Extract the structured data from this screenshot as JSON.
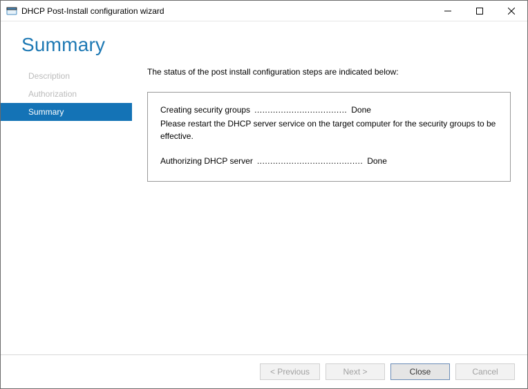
{
  "window": {
    "title": "DHCP Post-Install configuration wizard"
  },
  "header": {
    "title": "Summary"
  },
  "sidebar": {
    "items": [
      {
        "label": "Description",
        "active": false
      },
      {
        "label": "Authorization",
        "active": false
      },
      {
        "label": "Summary",
        "active": true
      }
    ]
  },
  "main": {
    "intro": "The status of the post install configuration steps are indicated below:",
    "status": {
      "lines": [
        {
          "label": "Creating security groups",
          "dots": "...................................",
          "result": "Done"
        },
        {
          "label": "Authorizing DHCP server",
          "dots": "........................................",
          "result": "Done"
        }
      ],
      "note": "Please restart the DHCP server service on the target computer for the security groups to be effective."
    }
  },
  "footer": {
    "previous": "< Previous",
    "next": "Next >",
    "close": "Close",
    "cancel": "Cancel"
  }
}
